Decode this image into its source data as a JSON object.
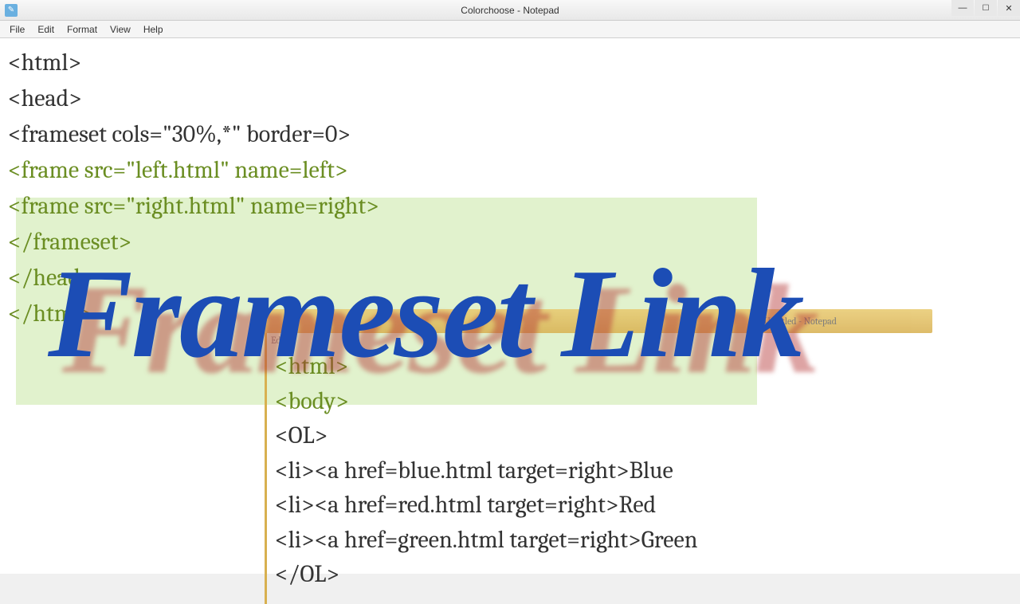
{
  "titlebar": {
    "title": "Colorchoose - Notepad",
    "icon_glyph": "✎"
  },
  "menu": {
    "items": [
      "File",
      "Edit",
      "Format",
      "View",
      "Help"
    ]
  },
  "main_code": {
    "l1": "<html>",
    "l2": "<head>",
    "l3": "<frameset cols=\"30%,*\" border=0>",
    "l4": "<frame src=\"left.html\" name=left>",
    "l5": "<frame src=\"right.html\" name=right>",
    "l6": "</frameset>",
    "l7": "</head>",
    "l8": "</html>"
  },
  "sub_window": {
    "title_hint": "Untitled - Notepad",
    "menu": [
      "Edit"
    ]
  },
  "sub_code": {
    "l1": "<html>",
    "l2": "<body>",
    "l3": "<OL>",
    "l4": "<li><a href=blue.html target=right>Blue",
    "l5": "<li><a href=red.html target=right>Red",
    "l6": "<li><a href=green.html target=right>Green",
    "l7": "</OL>"
  },
  "overlay": {
    "script_text": "Frameset Link"
  }
}
